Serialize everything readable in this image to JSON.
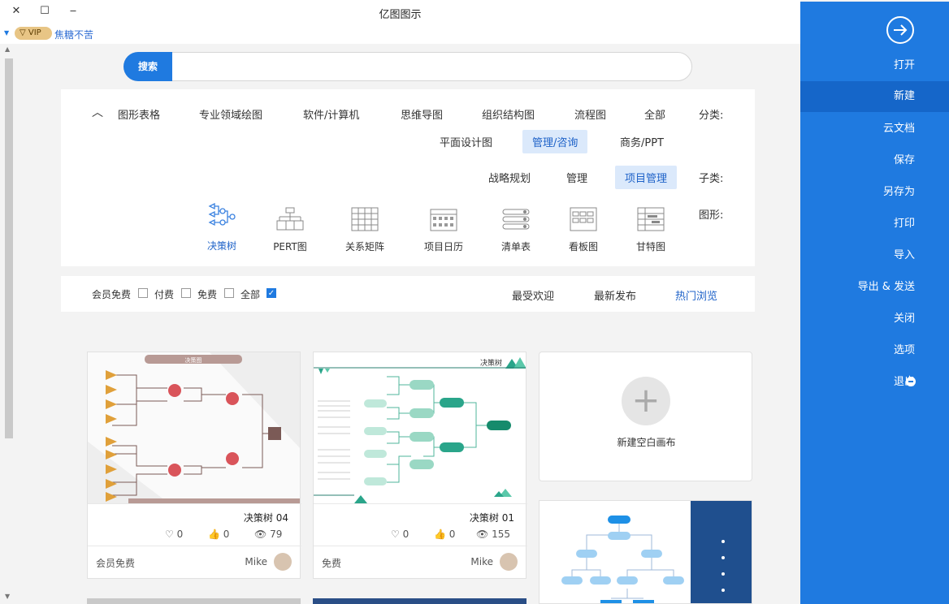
{
  "window": {
    "title": "亿图图示",
    "close_label": "✕",
    "max_label": "☐",
    "min_label": "‒"
  },
  "user": {
    "vip": "VIP",
    "name": "焦糖不苦"
  },
  "search": {
    "button_label": "搜索",
    "placeholder": ""
  },
  "filter": {
    "category_label": "分类:",
    "categories": [
      "全部",
      "流程图",
      "组织结构图",
      "思维导图",
      "软件/计算机",
      "专业领域绘图",
      "图形表格",
      "商务/PPT",
      "管理/咨询",
      "平面设计图"
    ],
    "selected_category": "管理/咨询",
    "subcategory_label": "子类:",
    "subcategories": [
      "项目管理",
      "管理",
      "战略规划"
    ],
    "selected_subcategory": "项目管理",
    "shape_label": "图形:",
    "shapes": [
      {
        "name": "甘特图",
        "icon": "gantt-icon"
      },
      {
        "name": "看板图",
        "icon": "kanban-icon"
      },
      {
        "name": "清单表",
        "icon": "checklist-icon"
      },
      {
        "name": "项目日历",
        "icon": "calendar-icon"
      },
      {
        "name": "关系矩阵",
        "icon": "matrix-icon"
      },
      {
        "name": "PERT图",
        "icon": "pert-icon"
      },
      {
        "name": "决策树",
        "icon": "decision-tree-icon"
      }
    ],
    "selected_shape": "决策树",
    "collapse_icon": "chevron-up-icon"
  },
  "sort": {
    "options": [
      "热门浏览",
      "最新发布",
      "最受欢迎"
    ],
    "selected": "热门浏览",
    "filters": [
      {
        "label": "全部",
        "checked": true
      },
      {
        "label": "免费",
        "checked": false
      },
      {
        "label": "付费",
        "checked": false
      },
      {
        "label": "会员免费",
        "checked": false
      }
    ]
  },
  "cards": {
    "new_blank": "新建空白画布",
    "items": [
      {
        "title": "决策树 01",
        "views": "155",
        "likes": "0",
        "favorites": "0",
        "author": "Mike",
        "price": "免费"
      },
      {
        "title": "决策树 04",
        "views": "79",
        "likes": "0",
        "favorites": "0",
        "author": "Mike",
        "price": "会员免费"
      }
    ]
  },
  "sidebar": {
    "items": [
      "打开",
      "新建",
      "云文档",
      "保存",
      "另存为",
      "打印",
      "导入",
      "导出 & 发送",
      "关闭",
      "选项",
      "退出"
    ],
    "selected": "新建"
  },
  "colors": {
    "accent": "#1f7ae0",
    "sidebar": "#1f7ae0",
    "selected_chip": "#dbe9fb"
  }
}
